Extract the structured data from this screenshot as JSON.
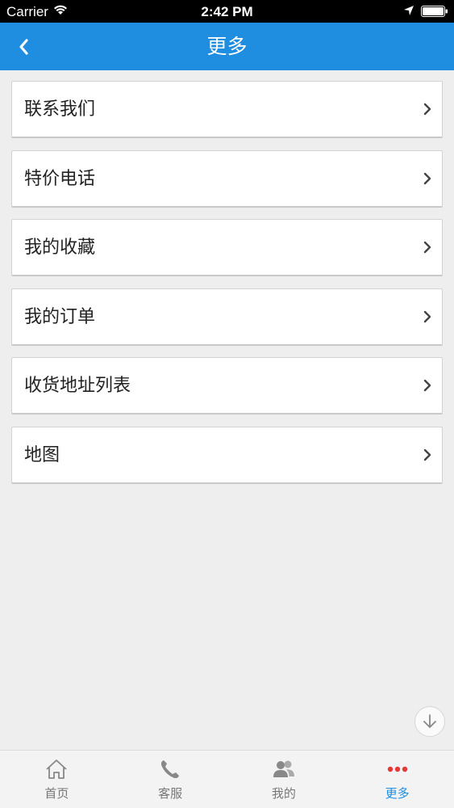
{
  "status_bar": {
    "carrier": "Carrier",
    "time": "2:42 PM"
  },
  "nav_bar": {
    "title": "更多",
    "back_icon": "chevron-left-icon"
  },
  "menu": {
    "items": [
      {
        "label": "联系我们"
      },
      {
        "label": "特价电话"
      },
      {
        "label": "我的收藏"
      },
      {
        "label": "我的订单"
      },
      {
        "label": "收货地址列表"
      },
      {
        "label": "地图"
      }
    ]
  },
  "tab_bar": {
    "tabs": [
      {
        "label": "首页",
        "icon": "home-icon",
        "active": false
      },
      {
        "label": "客服",
        "icon": "phone-icon",
        "active": false
      },
      {
        "label": "我的",
        "icon": "users-icon",
        "active": false
      },
      {
        "label": "更多",
        "icon": "more-dots-icon",
        "active": true
      }
    ]
  },
  "colors": {
    "accent": "#1f8ee0",
    "more_dots": "#e53935",
    "background": "#efeeee"
  }
}
